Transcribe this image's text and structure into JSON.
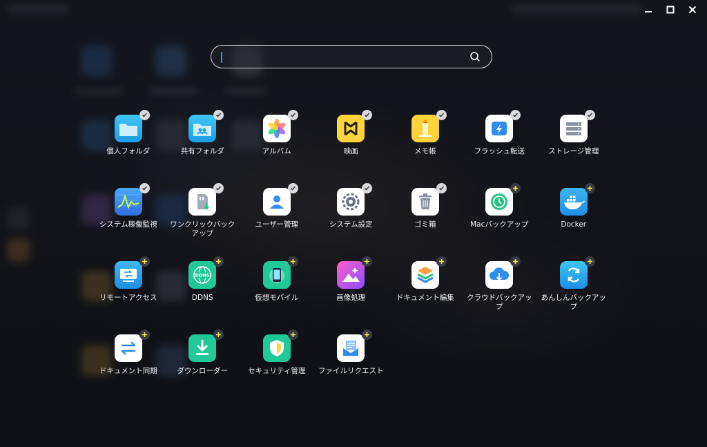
{
  "search": {
    "value": "",
    "placeholder": ""
  },
  "apps": [
    {
      "label": "個人フォルダ",
      "icon": "personal-folder-icon",
      "status": "installed"
    },
    {
      "label": "共有フォルダ",
      "icon": "shared-folder-icon",
      "status": "installed"
    },
    {
      "label": "アルバム",
      "icon": "album-icon",
      "status": "installed"
    },
    {
      "label": "映画",
      "icon": "movie-icon",
      "status": "installed"
    },
    {
      "label": "メモ帳",
      "icon": "notepad-icon",
      "status": "installed"
    },
    {
      "label": "フラッシュ転送",
      "icon": "flash-transfer-icon",
      "status": "installed"
    },
    {
      "label": "ストレージ管理",
      "icon": "storage-icon",
      "status": "installed"
    },
    {
      "label": "システム稼働監視",
      "icon": "system-monitor-icon",
      "status": "installed"
    },
    {
      "label": "ワンクリックバックアップ",
      "icon": "one-click-backup-icon",
      "status": "installed"
    },
    {
      "label": "ユーザー管理",
      "icon": "user-icon",
      "status": "installed"
    },
    {
      "label": "システム設定",
      "icon": "settings-gear-icon",
      "status": "installed"
    },
    {
      "label": "ゴミ箱",
      "icon": "trash-icon",
      "status": "installed"
    },
    {
      "label": "Macバックアップ",
      "icon": "mac-backup-icon",
      "status": "add"
    },
    {
      "label": "Docker",
      "icon": "docker-icon",
      "status": "add"
    },
    {
      "label": "リモートアクセス",
      "icon": "remote-access-icon",
      "status": "add"
    },
    {
      "label": "DDNS",
      "icon": "ddns-icon",
      "status": "add"
    },
    {
      "label": "仮想モバイル",
      "icon": "virtual-mobile-icon",
      "status": "add"
    },
    {
      "label": "画像処理",
      "icon": "image-processing-icon",
      "status": "add"
    },
    {
      "label": "ドキュメント編集",
      "icon": "document-edit-icon",
      "status": "add"
    },
    {
      "label": "クラウドバックアップ",
      "icon": "cloud-backup-icon",
      "status": "add"
    },
    {
      "label": "あんしんバックアップ",
      "icon": "secure-backup-icon",
      "status": "add"
    },
    {
      "label": "ドキュメント同期",
      "icon": "document-sync-icon",
      "status": "add"
    },
    {
      "label": "ダウンローダー",
      "icon": "downloader-icon",
      "status": "add"
    },
    {
      "label": "セキュリティ管理",
      "icon": "security-shield-icon",
      "status": "add"
    },
    {
      "label": "ファイルリクエスト",
      "icon": "file-request-icon",
      "status": "add"
    }
  ],
  "colors": {
    "installed_badge": "#d9d9de",
    "add_badge_plus": "#f5e94a",
    "accent": "#2f8cf0"
  }
}
